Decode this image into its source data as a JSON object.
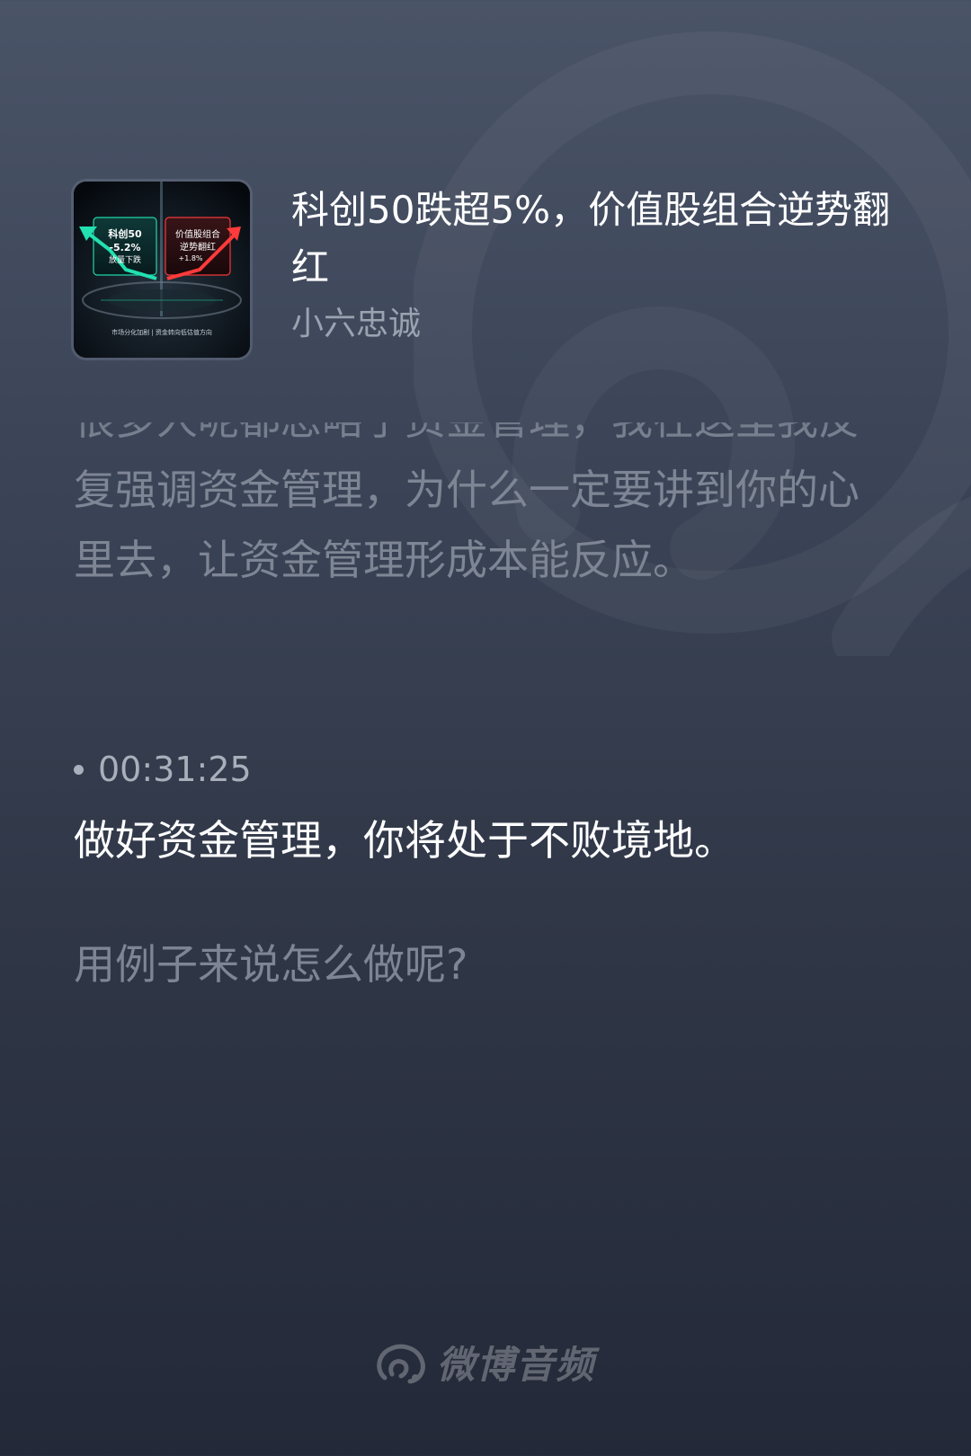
{
  "track": {
    "title": "科创50跌超5%，价值股组合逆势翻红",
    "author": "小六忠诚",
    "cover": {
      "left_label": "科创50",
      "left_value": "-5.2%",
      "left_sub": "放量下跌",
      "right_label": "价值股组合",
      "right_sub": "逆势翻红",
      "right_value": "+1.8%",
      "caption": "市场分化加剧 | 资金转向低估值方向",
      "left_color": "#22e0b0",
      "right_color": "#ff3b3b"
    }
  },
  "transcript": {
    "previous": "很多人呢都忽略了资金管理，我在这里我反复强调资金管理，为什么一定要讲到你的心里去，让资金管理形成本能反应。",
    "current_timestamp": "00:31:25",
    "current": "做好资金管理，你将处于不败境地。",
    "next": "用例子来说怎么做呢?"
  },
  "brand": {
    "name": "微博音频",
    "icon": "weibo-audio-logo-icon"
  }
}
